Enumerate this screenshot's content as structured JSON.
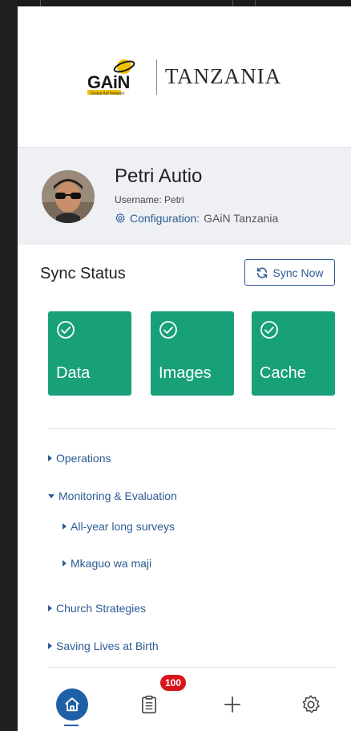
{
  "header": {
    "logo_word": "GAiN",
    "logo_tagline": "Global Aid Network",
    "country": "TANZANIA"
  },
  "profile": {
    "name": "Petri Autio",
    "username": "Username: Petri",
    "config_label": "Configuration:",
    "config_value": "GAiN Tanzania"
  },
  "sync": {
    "title": "Sync Status",
    "button_label": "Sync Now",
    "tiles": [
      {
        "label": "Data",
        "status": "synced"
      },
      {
        "label": "Images",
        "status": "synced"
      },
      {
        "label": "Cache",
        "status": "synced"
      }
    ]
  },
  "menu": {
    "operations": "Operations",
    "monitoring": "Monitoring & Evaluation",
    "surveys": "All-year long surveys",
    "mkaguo": "Mkaguo wa maji",
    "church": "Church Strategies",
    "saving": "Saving Lives at Birth"
  },
  "bottom_nav": {
    "tasks_badge": "100",
    "items": [
      "home-icon",
      "clipboard-icon",
      "plus-icon",
      "gear-icon"
    ]
  },
  "colors": {
    "accent": "#2d5b94",
    "tile_green": "#18a079",
    "home_blue": "#1f5fa6",
    "badge_red": "#d7141a"
  }
}
